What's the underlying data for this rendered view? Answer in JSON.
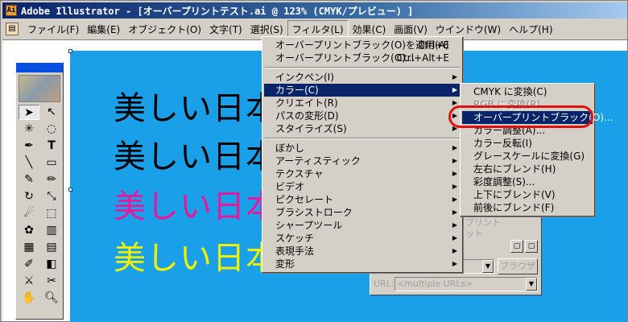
{
  "window": {
    "title": "Adobe Illustrator - [オーバープリントテスト.ai @ 123% (CMYK/プレビュー) ]"
  },
  "menubar": {
    "items": [
      {
        "label": "ファイル(F)"
      },
      {
        "label": "編集(E)"
      },
      {
        "label": "オブジェクト(O)"
      },
      {
        "label": "文字(T)"
      },
      {
        "label": "選択(S)"
      },
      {
        "label": "フィルタ(L)"
      },
      {
        "label": "効果(C)"
      },
      {
        "label": "画面(V)"
      },
      {
        "label": "ウインドウ(W)"
      },
      {
        "label": "ヘルプ(H)"
      }
    ],
    "active_index": 5
  },
  "canvas": {
    "background": "#1aa0e8",
    "samples": [
      {
        "text": "美しい日本",
        "color": "#000000"
      },
      {
        "text": "美しい日本",
        "color": "#000000"
      },
      {
        "text": "美しい日本",
        "color": "#e8189c"
      },
      {
        "text": "美しい日本",
        "color": "#f0f000"
      }
    ]
  },
  "tools": {
    "items": [
      "selection-arrow",
      "direct-select",
      "magic-wand",
      "lasso",
      "pen",
      "type",
      "line",
      "rectangle",
      "paintbrush",
      "pencil",
      "rotate",
      "scale",
      "warp",
      "free-transform",
      "symbol-sprayer",
      "graph",
      "mesh",
      "gradient",
      "eyedropper",
      "blend",
      "slice",
      "scissors",
      "hand",
      "zoom"
    ]
  },
  "filter_menu": {
    "items": [
      {
        "label": "オーバープリントブラック(O)を適用(A)",
        "shortcut": "Ctrl+E"
      },
      {
        "label": "オーバープリントブラック(O)...",
        "shortcut": "Ctrl+Alt+E"
      },
      {
        "separator": true
      },
      {
        "label": "インクペン(I)",
        "submenu": true
      },
      {
        "label": "カラー(C)",
        "submenu": true,
        "highlighted": true
      },
      {
        "label": "クリエイト(R)",
        "submenu": true
      },
      {
        "label": "パスの変形(D)",
        "submenu": true
      },
      {
        "label": "スタイライズ(S)",
        "submenu": true
      },
      {
        "separator": true
      },
      {
        "label": "ぼかし",
        "submenu": true
      },
      {
        "label": "アーティスティック",
        "submenu": true
      },
      {
        "label": "テクスチャ",
        "submenu": true
      },
      {
        "label": "ビデオ",
        "submenu": true
      },
      {
        "label": "ピクセレート",
        "submenu": true
      },
      {
        "label": "ブラシストローク",
        "submenu": true
      },
      {
        "label": "シャープツール",
        "submenu": true
      },
      {
        "label": "スケッチ",
        "submenu": true
      },
      {
        "label": "表現手法",
        "submenu": true
      },
      {
        "label": "変形",
        "submenu": true
      }
    ]
  },
  "color_submenu": {
    "items": [
      {
        "label": "CMYK に変換(C)"
      },
      {
        "label": "RGB に変換(R)",
        "disabled": true
      },
      {
        "label": "オーバープリントブラック(O)...",
        "highlighted": true
      },
      {
        "label": "カラー調整(A)..."
      },
      {
        "label": "カラー反転(I)"
      },
      {
        "label": "グレースケールに変換(G)"
      },
      {
        "label": "左右にブレンド(H)"
      },
      {
        "label": "彩度調整(S)..."
      },
      {
        "label": "上下にブレンド(V)"
      },
      {
        "label": "前後にブレンド(F)"
      }
    ]
  },
  "bg_panel": {
    "line1": "プリント",
    "line2": "ット",
    "browse_label": "ブラウザ",
    "url_label": "URL:",
    "url_value": "<multiple URLs>"
  },
  "colors": {
    "highlight": "#0a246a",
    "callout_ring": "#e01010",
    "title_gradient_start": "#0a246a"
  }
}
